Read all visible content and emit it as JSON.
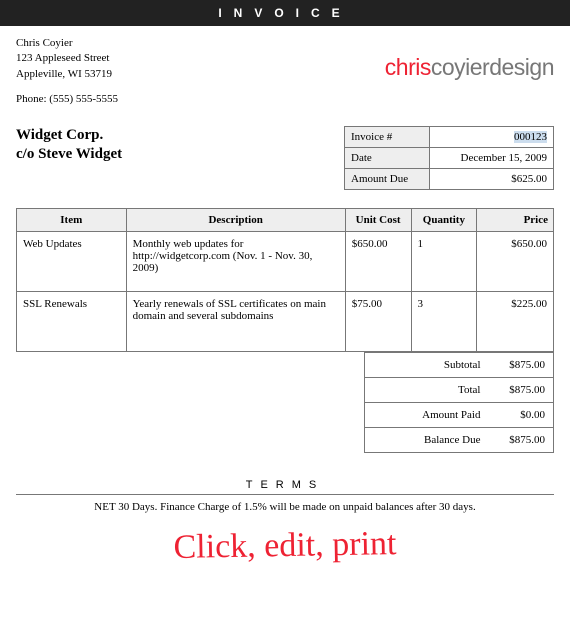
{
  "banner": "INVOICE",
  "sender": {
    "name": "Chris Coyier",
    "street": "123 Appleseed Street",
    "citystate": "Appleville, WI 53719",
    "phone": "Phone: (555) 555-5555"
  },
  "logo": {
    "red": "chris",
    "gray1": "coyier",
    "gray2": "design"
  },
  "client": {
    "line1": "Widget Corp.",
    "line2": "c/o Steve Widget"
  },
  "meta": {
    "labels": {
      "inv": "Invoice #",
      "date": "Date",
      "due": "Amount Due"
    },
    "invoice_no": "000123",
    "date": "December 15, 2009",
    "amount_due": "$625.00"
  },
  "headers": {
    "item": "Item",
    "desc": "Description",
    "uc": "Unit Cost",
    "qty": "Quantity",
    "price": "Price"
  },
  "rows": [
    {
      "item": "Web Updates",
      "desc": "Monthly web updates for http://widgetcorp.com (Nov. 1 - Nov. 30, 2009)",
      "uc": "$650.00",
      "qty": "1",
      "price": "$650.00"
    },
    {
      "item": "SSL Renewals",
      "desc": "Yearly renewals of SSL certificates on main domain and several subdomains",
      "uc": "$75.00",
      "qty": "3",
      "price": "$225.00"
    }
  ],
  "totals": {
    "subtotal_l": "Subtotal",
    "subtotal_v": "$875.00",
    "total_l": "Total",
    "total_v": "$875.00",
    "paid_l": "Amount Paid",
    "paid_v": "$0.00",
    "balance_l": "Balance Due",
    "balance_v": "$875.00"
  },
  "terms": {
    "header": "TERMS",
    "text": "NET 30 Days. Finance Charge of 1.5% will be made on unpaid balances after 30 days."
  },
  "handwrite": "Click, edit, print"
}
